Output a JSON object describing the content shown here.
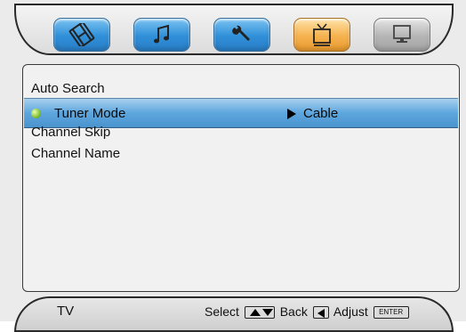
{
  "tabs": [
    {
      "icon": "film-icon",
      "color": "#2f8fd8",
      "selected": false
    },
    {
      "icon": "music-note-icon",
      "color": "#2f8fd8",
      "selected": false
    },
    {
      "icon": "wrench-icon",
      "color": "#2f8fd8",
      "selected": false
    },
    {
      "icon": "tv-icon",
      "color": "#f5b24f",
      "selected": true
    },
    {
      "icon": "monitor-icon",
      "color": "#b5b5b5",
      "selected": false
    }
  ],
  "menu": {
    "items": [
      {
        "label": "Auto Search"
      },
      {
        "label": "Tuner Mode",
        "value": "Cable",
        "selected": true
      },
      {
        "label": "Channel Skip"
      },
      {
        "label": "Channel Name"
      }
    ]
  },
  "footer": {
    "mode": "TV",
    "select_label": "Select",
    "back_label": "Back",
    "adjust_label": "Adjust",
    "enter_key": "ENTER"
  },
  "colors": {
    "selection": "#5da6de",
    "indicator": "#8cc63c",
    "panel_bg": "#f1f1f1"
  }
}
